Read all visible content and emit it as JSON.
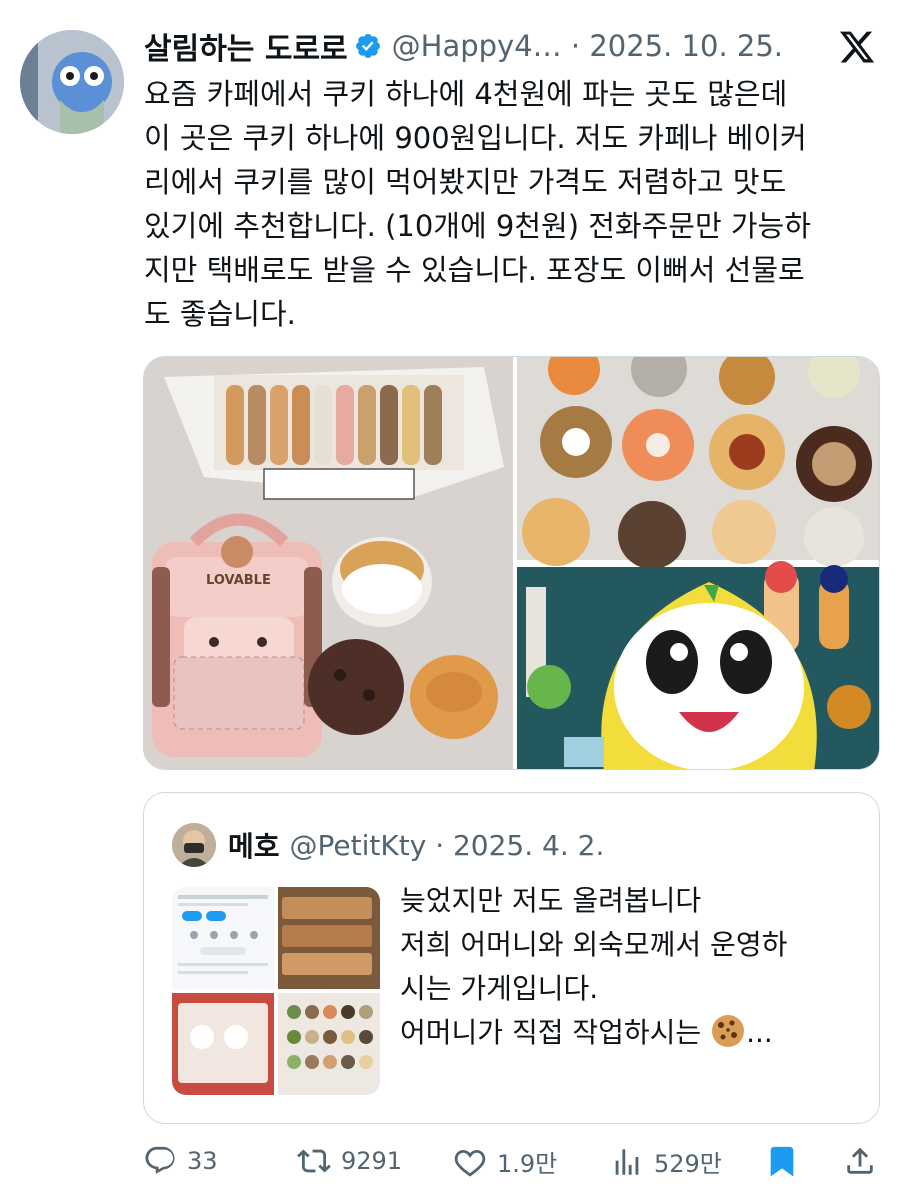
{
  "tweet": {
    "author_name": "살림하는 도로로",
    "handle_date": "@Happy4… · 2025. 10. 25.",
    "text": "요즘 카페에서 쿠키 하나에 4천원에 파는 곳도 많은데\n이 곳은 쿠키 하나에 900원입니다. 저도 카페나 베이커\n리에서 쿠키를 많이 먹어봤지만 가격도 저렴하고 맛도\n있기에 추천합니다. (10개에 9천원) 전화주문만 가능하\n지만 택배로도 받을 수 있습니다. 포장도 이뻐서 선물로\n도 좋습니다.",
    "box_label": "LOVABLE"
  },
  "quote": {
    "author_name": "메호",
    "handle_date": "@PetitKty · 2025. 4. 2.",
    "text": "늦었지만 저도 올려봅니다\n저희 어머니와 외숙모께서 운영하\n시는 가게입니다.\n어머니가 직접 작업하시는 ",
    "ellipsis": "..."
  },
  "actions": {
    "replies": "33",
    "retweets": "9291",
    "likes": "1.9만",
    "views": "529만"
  },
  "icons": {
    "verified": "verified-badge-icon",
    "x_logo": "x-logo-icon",
    "reply": "reply-icon",
    "retweet": "retweet-icon",
    "like": "heart-icon",
    "views": "views-icon",
    "bookmark": "bookmark-icon",
    "share": "share-icon",
    "cookie": "cookie-emoji-icon"
  },
  "colors": {
    "text": "#0f1419",
    "secondary": "#536471",
    "verified": "#1d9bf0",
    "bookmark": "#1d9bf0",
    "border": "#cfd9de"
  }
}
